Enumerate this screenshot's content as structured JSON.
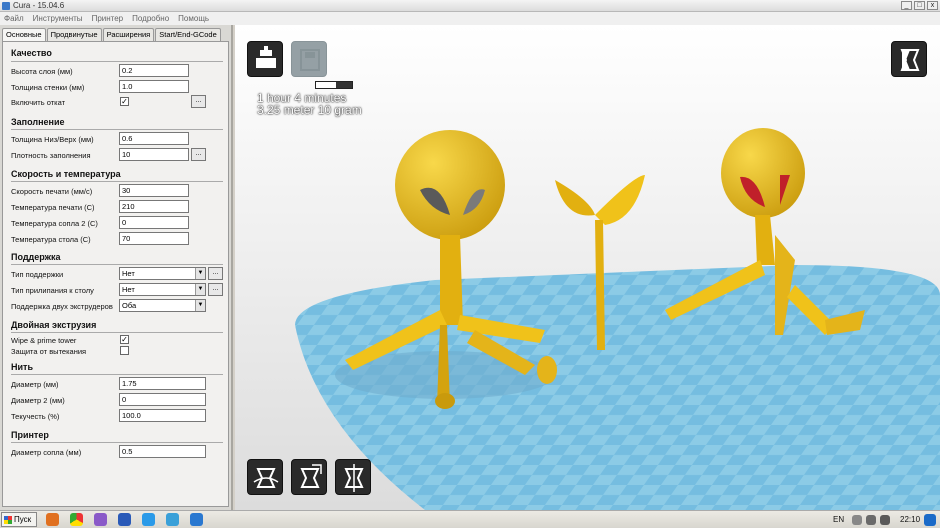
{
  "window": {
    "title": "Cura - 15.04.6",
    "min": "_",
    "max": "□",
    "close": "x"
  },
  "menu": [
    "Файл",
    "Инструменты",
    "Принтер",
    "Подробно",
    "Помощь"
  ],
  "tabs": [
    "Основные",
    "Продвинутые",
    "Расширения",
    "Start/End-GCode"
  ],
  "sections": {
    "quality": {
      "title": "Качество",
      "layer_height_label": "Высота слоя (мм)",
      "layer_height": "0.2",
      "shell_label": "Толщина стенки (мм)",
      "shell": "1.0",
      "retraction_label": "Включить откат",
      "retraction_checked": "✓"
    },
    "fill": {
      "title": "Заполнение",
      "bottom_top_label": "Толщина Низ/Верх (мм)",
      "bottom_top": "0.6",
      "density_label": "Плотность заполнения",
      "density": "10"
    },
    "speed": {
      "title": "Скорость и температура",
      "print_speed_label": "Скорость печати (мм/с)",
      "print_speed": "30",
      "print_temp_label": "Температура печати (C)",
      "print_temp": "210",
      "temp2_label": "Температура сопла 2 (C)",
      "temp2": "0",
      "bed_temp_label": "Температура стола (C)",
      "bed_temp": "70"
    },
    "support": {
      "title": "Поддержка",
      "support_type_label": "Тип поддержки",
      "support_type": "Нет",
      "adhesion_label": "Тип прилипания к столу",
      "adhesion": "Нет",
      "dual_support_label": "Поддержка двух экструдеров",
      "dual_support": "Оба"
    },
    "dual": {
      "title": "Двойная экструзия",
      "wipe_label": "Wipe & prime tower",
      "wipe_checked": "✓",
      "ooze_label": "Защита от вытекания"
    },
    "filament": {
      "title": "Нить",
      "diameter_label": "Диаметр (мм)",
      "diameter": "1.75",
      "diameter2_label": "Диаметр 2 (мм)",
      "diameter2": "0",
      "flow_label": "Текучесть (%)",
      "flow": "100.0"
    },
    "machine": {
      "title": "Принтер",
      "nozzle_label": "Диаметр сопла (мм)",
      "nozzle": "0.5"
    }
  },
  "button_dots": "...",
  "estimate": {
    "time": "1 hour 4 minutes",
    "material": "3.25 meter 10 gram",
    "progress": 0.55
  },
  "colors": {
    "object": "#f0c21a",
    "bed": "#8ccbe6",
    "dark_tool": "#2a2a2a"
  },
  "icons": [
    "load-model-icon",
    "save-gcode-icon",
    "view-mode-icon",
    "rotate-icon",
    "scale-icon",
    "mirror-icon"
  ],
  "taskbar": {
    "start": "Пуск",
    "lang": "EN",
    "clock": "22:10"
  }
}
